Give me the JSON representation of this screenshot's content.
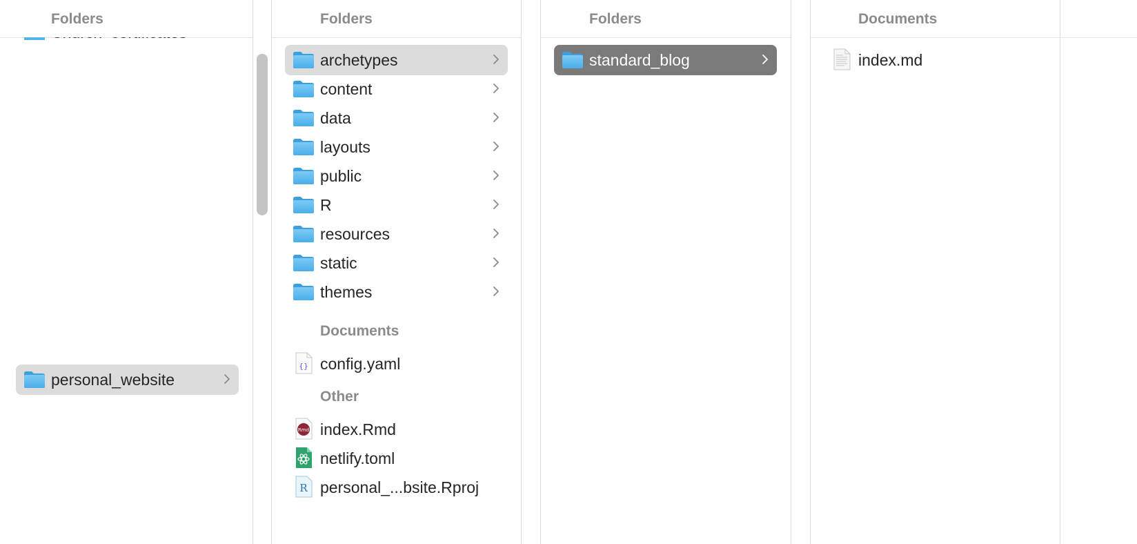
{
  "columns": [
    {
      "header": "Folders",
      "partial_item": "Church_certificates",
      "items": [
        {
          "label": "personal_website",
          "selected": true
        }
      ]
    },
    {
      "header": "Folders",
      "items": [
        {
          "label": "archetypes",
          "selected": true
        },
        {
          "label": "content"
        },
        {
          "label": "data"
        },
        {
          "label": "layouts"
        },
        {
          "label": "public"
        },
        {
          "label": "R"
        },
        {
          "label": "resources"
        },
        {
          "label": "static"
        },
        {
          "label": "themes"
        }
      ],
      "documents_title": "Documents",
      "documents": [
        {
          "label": "config.yaml",
          "icon": "yaml-file-icon"
        }
      ],
      "other_title": "Other",
      "other": [
        {
          "label": "index.Rmd",
          "icon": "rmarkdown-file-icon"
        },
        {
          "label": "netlify.toml",
          "icon": "toml-file-icon"
        },
        {
          "label": "personal_...bsite.Rproj",
          "icon": "rproj-file-icon"
        }
      ]
    },
    {
      "header": "Folders",
      "items": [
        {
          "label": "standard_blog",
          "selected": true,
          "active": true
        }
      ]
    },
    {
      "header": "Documents",
      "items": [
        {
          "label": "index.md",
          "icon": "text-document-icon"
        }
      ]
    }
  ],
  "colors": {
    "folder_blue": "#5ab8f0",
    "selection_light": "#dcdcdc",
    "selection_dark": "#7a7a7a",
    "header_text": "#8b8b8b"
  }
}
